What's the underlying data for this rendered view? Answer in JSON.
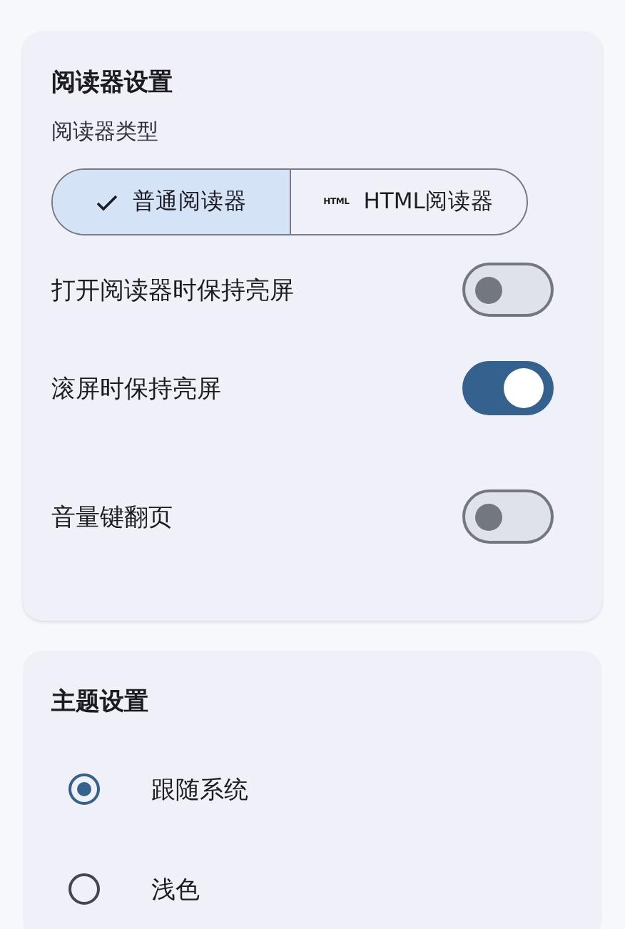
{
  "reader_settings": {
    "title": "阅读器设置",
    "reader_type_label": "阅读器类型",
    "reader_types": [
      {
        "label": "普通阅读器",
        "selected": true,
        "kind": "check"
      },
      {
        "label": "HTML阅读器",
        "selected": false,
        "kind": "html",
        "icon_text": "HTML"
      }
    ],
    "toggles": [
      {
        "label": "打开阅读器时保持亮屏",
        "on": false
      },
      {
        "label": "滚屏时保持亮屏",
        "on": true
      },
      {
        "label": "音量键翻页",
        "on": false
      }
    ]
  },
  "theme_settings": {
    "title": "主题设置",
    "options": [
      {
        "label": "跟随系统",
        "selected": true
      },
      {
        "label": "浅色",
        "selected": false
      }
    ]
  }
}
